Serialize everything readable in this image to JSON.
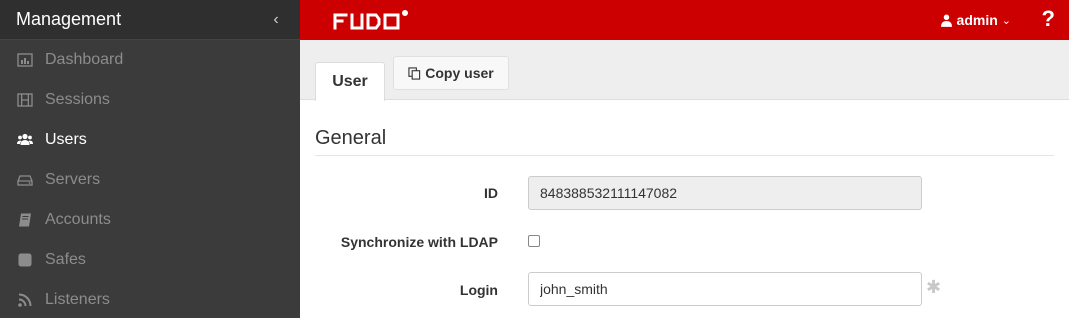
{
  "sidebar": {
    "title": "Management",
    "collapse_icon": "chevron-left-icon",
    "items": [
      {
        "label": "Dashboard",
        "icon": "bar-chart-icon",
        "active": false
      },
      {
        "label": "Sessions",
        "icon": "film-icon",
        "active": false
      },
      {
        "label": "Users",
        "icon": "users-icon",
        "active": true
      },
      {
        "label": "Servers",
        "icon": "hdd-icon",
        "active": false
      },
      {
        "label": "Accounts",
        "icon": "book-icon",
        "active": false
      },
      {
        "label": "Safes",
        "icon": "safe-icon",
        "active": false
      },
      {
        "label": "Listeners",
        "icon": "rss-icon",
        "active": false
      }
    ]
  },
  "topbar": {
    "logo_text": "FUDO",
    "user_label": "admin",
    "help_label": "?",
    "brand_color": "#cc0000"
  },
  "tabs": {
    "user_label": "User",
    "copy_label": "Copy user"
  },
  "section": {
    "title": "General"
  },
  "form": {
    "id_label": "ID",
    "id_value": "848388532111147082",
    "ldap_label": "Synchronize with LDAP",
    "ldap_checked": false,
    "login_label": "Login",
    "login_value": "john_smith"
  }
}
